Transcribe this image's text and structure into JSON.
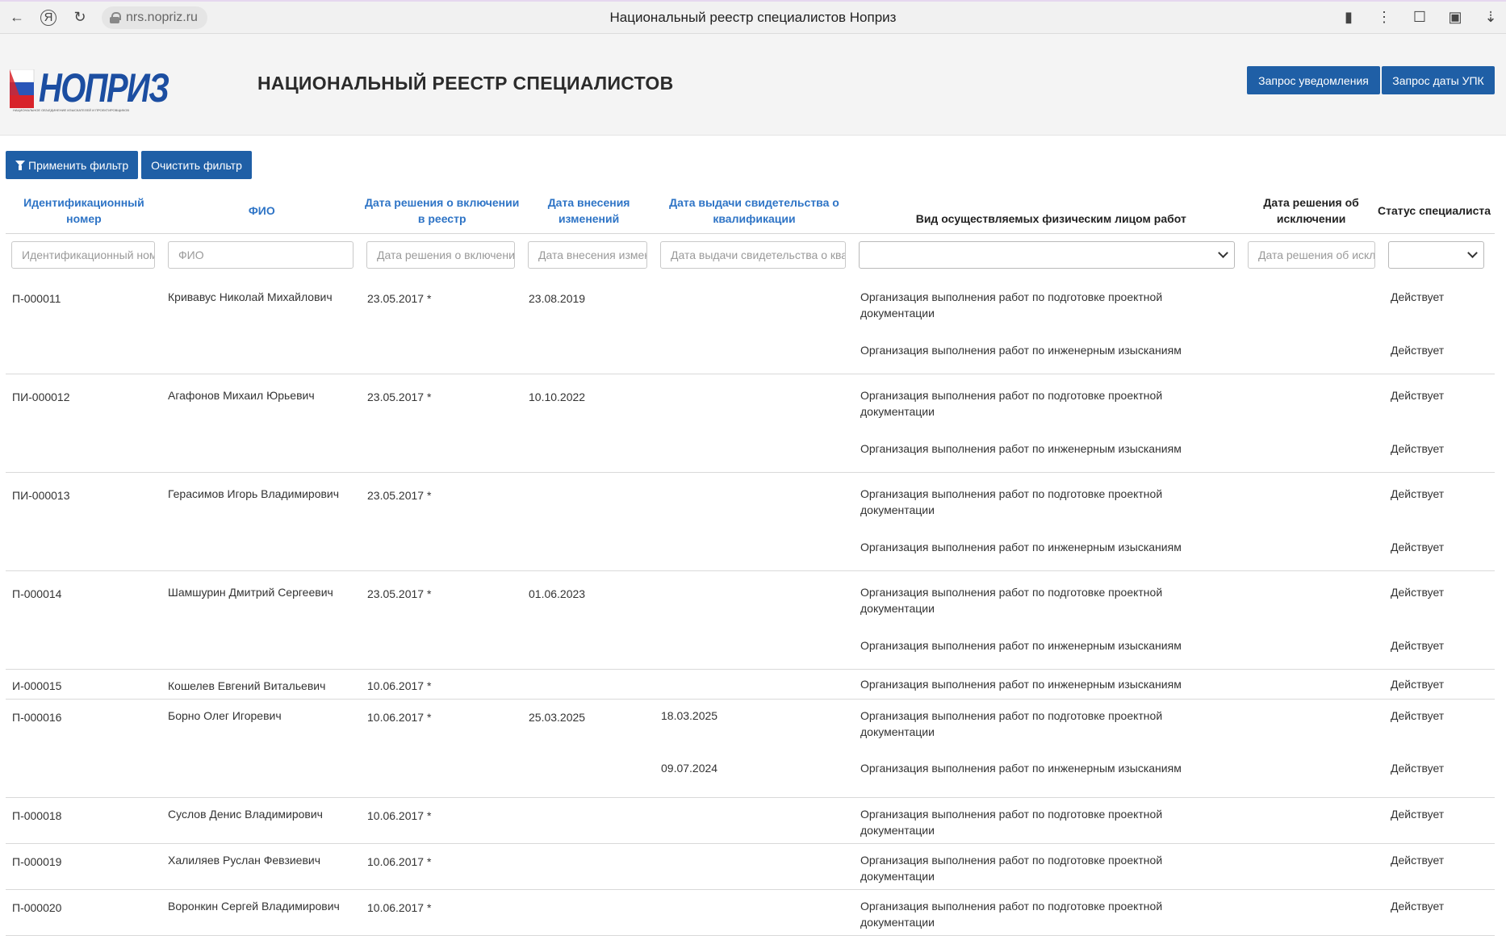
{
  "browser": {
    "url": "nrs.nopriz.ru",
    "tab_title": "Национальный реестр специалистов Ноприз"
  },
  "header": {
    "logo_text": "НОПРИЗ",
    "logo_subtitle": "НАЦИОНАЛЬНОЕ ОБЪЕДИНЕНИЕ ИЗЫСКАТЕЛЕЙ И ПРОЕКТИРОВЩИКОВ",
    "title": "НАЦИОНАЛЬНЫЙ РЕЕСТР СПЕЦИАЛИСТОВ",
    "btn_notify": "Запрос уведомления",
    "btn_upk": "Запрос даты УПК"
  },
  "filters": {
    "apply": "Применить фильтр",
    "clear": "Очистить фильтр"
  },
  "columns": {
    "id": "Идентификационный номер",
    "fio": "ФИО",
    "date_incl": "Дата решения о включении в реестр",
    "date_change": "Дата внесения изменений",
    "date_cert": "Дата выдачи свидетельства о квалификации",
    "work": "Вид осуществляемых физическим лицом работ",
    "date_excl": "Дата решения об исключении",
    "status": "Статус специалиста"
  },
  "placeholders": {
    "id": "Идентификационный номер",
    "fio": "ФИО",
    "date_incl": "Дата решения о включении в реестр",
    "date_change": "Дата внесения изменений",
    "date_cert": "Дата выдачи свидетельства о квалификации",
    "date_excl": "Дата решения об исключении"
  },
  "rows": [
    {
      "id": "П-000011",
      "fio": "Кривавус Николай Михайлович",
      "date_incl": "23.05.2017 *",
      "date_change": "23.08.2019",
      "cert1": "",
      "cert2": "",
      "work1": "Организация выполнения работ по подготовке проектной документации",
      "work2": "Организация выполнения работ по инженерным изысканиям",
      "status1": "Действует",
      "status2": "Действует"
    },
    {
      "id": "ПИ-000012",
      "fio": "Агафонов Михаил Юрьевич",
      "date_incl": "23.05.2017 *",
      "date_change": "10.10.2022",
      "cert1": "",
      "cert2": "",
      "work1": "Организация выполнения работ по подготовке проектной документации",
      "work2": "Организация выполнения работ по инженерным изысканиям",
      "status1": "Действует",
      "status2": "Действует"
    },
    {
      "id": "ПИ-000013",
      "fio": "Герасимов Игорь Владимирович",
      "date_incl": "23.05.2017 *",
      "date_change": "",
      "cert1": "",
      "cert2": "",
      "work1": "Организация выполнения работ по подготовке проектной документации",
      "work2": "Организация выполнения работ по инженерным изысканиям",
      "status1": "Действует",
      "status2": "Действует"
    },
    {
      "id": "П-000014",
      "fio": "Шамшурин Дмитрий Сергеевич",
      "date_incl": "23.05.2017 *",
      "date_change": "01.06.2023",
      "cert1": "",
      "cert2": "",
      "work1": "Организация выполнения работ по подготовке проектной документации",
      "work2": "Организация выполнения работ по инженерным изысканиям",
      "status1": "Действует",
      "status2": "Действует"
    },
    {
      "id": "И-000015",
      "fio": "Кошелев Евгений Витальевич",
      "date_incl": "10.06.2017 *",
      "date_change": "",
      "work1": "Организация выполнения работ по инженерным изысканиям",
      "status1": "Действует"
    },
    {
      "id": "П-000016",
      "fio": "Борно Олег Игоревич",
      "date_incl": "10.06.2017 *",
      "date_change": "25.03.2025",
      "cert1": "18.03.2025",
      "cert2": "09.07.2024",
      "work1": "Организация выполнения работ по подготовке проектной документации",
      "work2": "Организация выполнения работ по инженерным изысканиям",
      "status1": "Действует",
      "status2": "Действует"
    },
    {
      "id": "П-000018",
      "fio": "Суслов Денис Владимирович",
      "date_incl": "10.06.2017 *",
      "date_change": "",
      "work1": "Организация выполнения работ по подготовке проектной документации",
      "status1": "Действует"
    },
    {
      "id": "П-000019",
      "fio": "Халиляев Руслан Февзиевич",
      "date_incl": "10.06.2017 *",
      "date_change": "",
      "work1": "Организация выполнения работ по подготовке проектной документации",
      "status1": "Действует"
    },
    {
      "id": "П-000020",
      "fio": "Воронкин Сергей Владимирович",
      "date_incl": "10.06.2017 *",
      "date_change": "",
      "work1": "Организация выполнения работ по подготовке проектной документации",
      "status1": "Действует"
    }
  ]
}
